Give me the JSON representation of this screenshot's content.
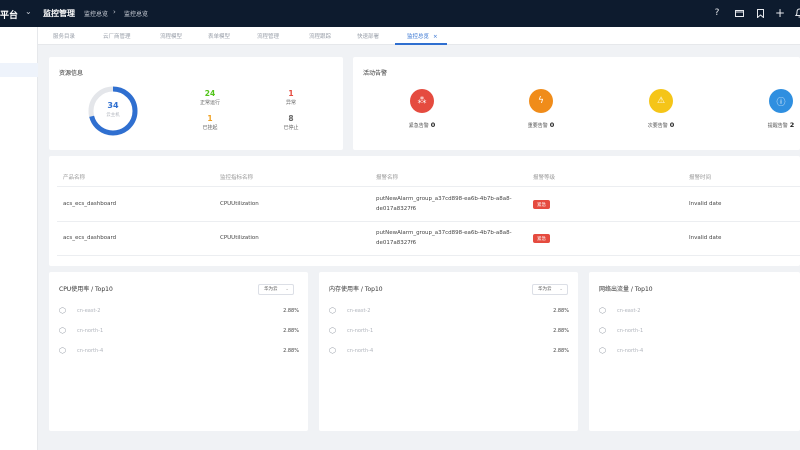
{
  "header": {
    "brand": "平台",
    "module": "监控管理",
    "breadcrumb": [
      "监控总览",
      "监控总览"
    ],
    "icons": [
      "help-icon",
      "folder-icon",
      "bookmark-icon",
      "plus-icon",
      "bell-icon"
    ],
    "help_glyph": "?",
    "plus_glyph": "+"
  },
  "tabs": [
    {
      "label": "服务目录"
    },
    {
      "label": "云厂商管理"
    },
    {
      "label": "流程模型"
    },
    {
      "label": "表单模型"
    },
    {
      "label": "流程管理"
    },
    {
      "label": "流程跟踪"
    },
    {
      "label": "快速部署"
    },
    {
      "label": "监控总览",
      "active": true
    }
  ],
  "tab_close": "×",
  "resource": {
    "title": "资源信息",
    "total": "34",
    "total_label": "云主机",
    "running_ratio": 0.71,
    "stats": [
      {
        "value": "24",
        "label": "正常运行",
        "color": "#52c41a"
      },
      {
        "value": "1",
        "label": "异常",
        "color": "#e54b3f"
      },
      {
        "value": "1",
        "label": "已挂起",
        "color": "#f0a020"
      },
      {
        "value": "8",
        "label": "已停止",
        "color": "#666666"
      }
    ]
  },
  "alarms": {
    "title": "活动告警",
    "items": [
      {
        "label": "紧急告警",
        "count": "0",
        "color": "#e54b3f",
        "icon": "fire-icon",
        "glyph": "⁂"
      },
      {
        "label": "重要告警",
        "count": "0",
        "color": "#f08c1a",
        "icon": "lightning-icon",
        "glyph": "ϟ"
      },
      {
        "label": "次要告警",
        "count": "0",
        "color": "#f5c518",
        "icon": "warning-icon",
        "glyph": "⚠"
      },
      {
        "label": "提醒告警",
        "count": "2",
        "color": "#2f8fe0",
        "icon": "info-icon",
        "glyph": "ⓘ"
      }
    ]
  },
  "alarm_table": {
    "columns": [
      "产品名称",
      "监控指标名称",
      "报警名称",
      "报警等级",
      "报警时间"
    ],
    "rows": [
      {
        "product": "acs_ecs_dashboard",
        "metric": "CPUUtilization",
        "name": "putNewAlarm_group_a37cd898-ea6b-4b7b-a8a8-de017a8327f6",
        "level": "紧急",
        "time": "Invalid date"
      },
      {
        "product": "acs_ecs_dashboard",
        "metric": "CPUUtilization",
        "name": "putNewAlarm_group_a37cd898-ea6b-4b7b-a8a8-de017a8327f6",
        "level": "紧急",
        "time": "Invalid date"
      }
    ]
  },
  "top_cards": [
    {
      "title": "CPU使用率 / Top10",
      "select": "华为云",
      "rows": [
        {
          "region": "cn-east-2",
          "value": "2.88%"
        },
        {
          "region": "cn-north-1",
          "value": "2.88%"
        },
        {
          "region": "cn-north-4",
          "value": "2.88%"
        }
      ]
    },
    {
      "title": "内存使用率 / Top10",
      "select": "华为云",
      "rows": [
        {
          "region": "cn-east-2",
          "value": "2.88%"
        },
        {
          "region": "cn-north-1",
          "value": "2.88%"
        },
        {
          "region": "cn-north-4",
          "value": "2.88%"
        }
      ]
    },
    {
      "title": "网络出流量 / Top10",
      "select": "",
      "rows": [
        {
          "region": "cn-east-2",
          "value": ""
        },
        {
          "region": "cn-north-1",
          "value": ""
        },
        {
          "region": "cn-north-4",
          "value": ""
        }
      ]
    }
  ]
}
